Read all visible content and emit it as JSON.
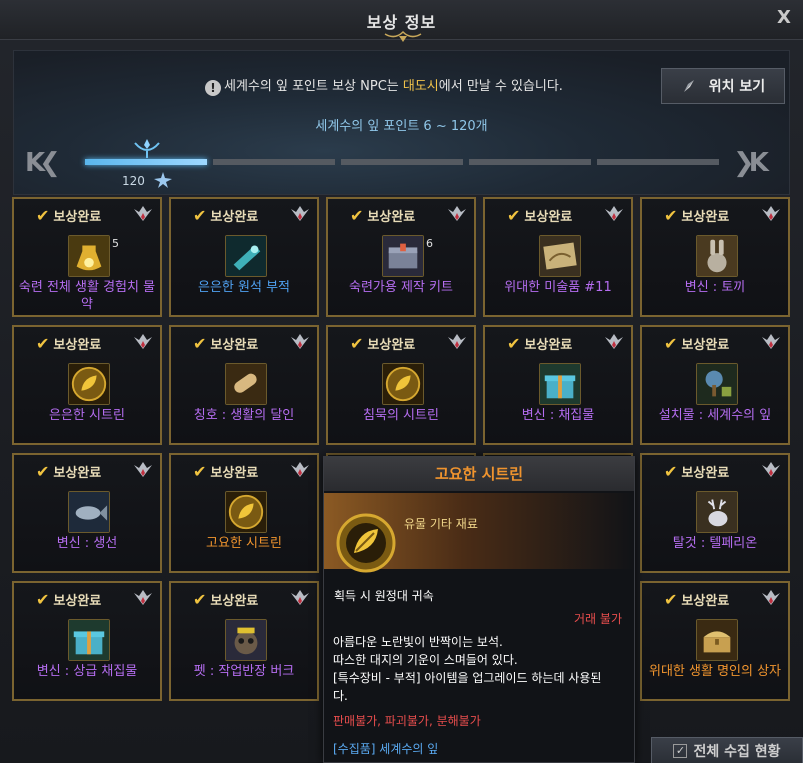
{
  "window": {
    "title": "보상 정보",
    "close_label": "X"
  },
  "notice": {
    "prefix": "세계수의 잎 포인트 보상 NPC는 ",
    "highlight": "대도시",
    "suffix": "에서 만날 수 있습니다.",
    "icon": "info-icon"
  },
  "location_button": {
    "label": "위치 보기",
    "icon": "map-pin-icon"
  },
  "range_text": "세계수의 잎 포인트 6 ~ 120개",
  "progress": {
    "milestone": "120",
    "active_segment": 1,
    "total_segments": 5
  },
  "status_label": "보상완료",
  "rewards": [
    {
      "name": "숙련 전체 생활 경험치 물약",
      "qty": "5",
      "grade": "purple",
      "icon": "potion-icon"
    },
    {
      "name": "은은한 원석 부적",
      "qty": "",
      "grade": "blue",
      "icon": "gem-amulet-icon"
    },
    {
      "name": "숙련가용 제작 키트",
      "qty": "6",
      "grade": "purple",
      "icon": "crafting-kit-icon"
    },
    {
      "name": "위대한 미술품 #11",
      "qty": "",
      "grade": "purple",
      "icon": "painting-icon"
    },
    {
      "name": "변신 : 토끼",
      "qty": "",
      "grade": "purple",
      "icon": "rabbit-icon"
    },
    {
      "name": "은은한 시트린",
      "qty": "",
      "grade": "purple",
      "icon": "citrine-icon"
    },
    {
      "name": "칭호 : 생활의 달인",
      "qty": "",
      "grade": "purple",
      "icon": "scroll-icon"
    },
    {
      "name": "침묵의 시트린",
      "qty": "",
      "grade": "purple",
      "icon": "citrine-icon"
    },
    {
      "name": "변신 : 채집물",
      "qty": "",
      "grade": "purple",
      "icon": "gift-box-icon"
    },
    {
      "name": "설치물 : 세계수의 잎",
      "qty": "",
      "grade": "purple",
      "icon": "tree-icon"
    },
    {
      "name": "변신 : 생선",
      "qty": "",
      "grade": "purple",
      "icon": "fish-icon"
    },
    {
      "name": "고요한 시트린",
      "qty": "",
      "grade": "orange",
      "icon": "citrine-icon"
    },
    {
      "name": "",
      "qty": "",
      "grade": "purple",
      "icon": ""
    },
    {
      "name": "",
      "qty": "",
      "grade": "purple",
      "icon": ""
    },
    {
      "name": "탈것 : 텔페리온",
      "qty": "",
      "grade": "purple",
      "icon": "elk-icon"
    },
    {
      "name": "변신 : 상급 채집물",
      "qty": "",
      "grade": "purple",
      "icon": "gift-box-icon"
    },
    {
      "name": "펫 : 작업반장 버크",
      "qty": "",
      "grade": "purple",
      "icon": "raccoon-icon"
    },
    {
      "name": "",
      "qty": "",
      "grade": "purple",
      "icon": ""
    },
    {
      "name": "",
      "qty": "",
      "grade": "purple",
      "icon": ""
    },
    {
      "name": "위대한 생활 명인의 상자",
      "qty": "",
      "grade": "orange",
      "icon": "chest-icon"
    }
  ],
  "tooltip": {
    "title": "고요한 시트린",
    "type": "유물 기타 재료",
    "bind": "획득 시 원정대 귀속",
    "trade": "거래 불가",
    "desc": [
      "아름다운 노란빛이 반짝이는 보석.",
      "따스한 대지의 기운이 스며들어 있다.",
      "[특수장비 - 부적] 아이템을 업그레이드 하는데 사용된",
      "다."
    ],
    "restrictions": "판매불가, 파괴불가, 분해불가",
    "collection": "[수집품] 세계수의 잎",
    "icon": "citrine-icon"
  },
  "footer_button": {
    "label": "전체 수집 현황",
    "icon": "checkbox-icon"
  },
  "colors": {
    "accent": "#f0c24a",
    "progress": "#5ab6ec",
    "border": "#7b6430",
    "purple": "#b56df0",
    "orange": "#f0942e",
    "blue": "#4fa0f0"
  }
}
